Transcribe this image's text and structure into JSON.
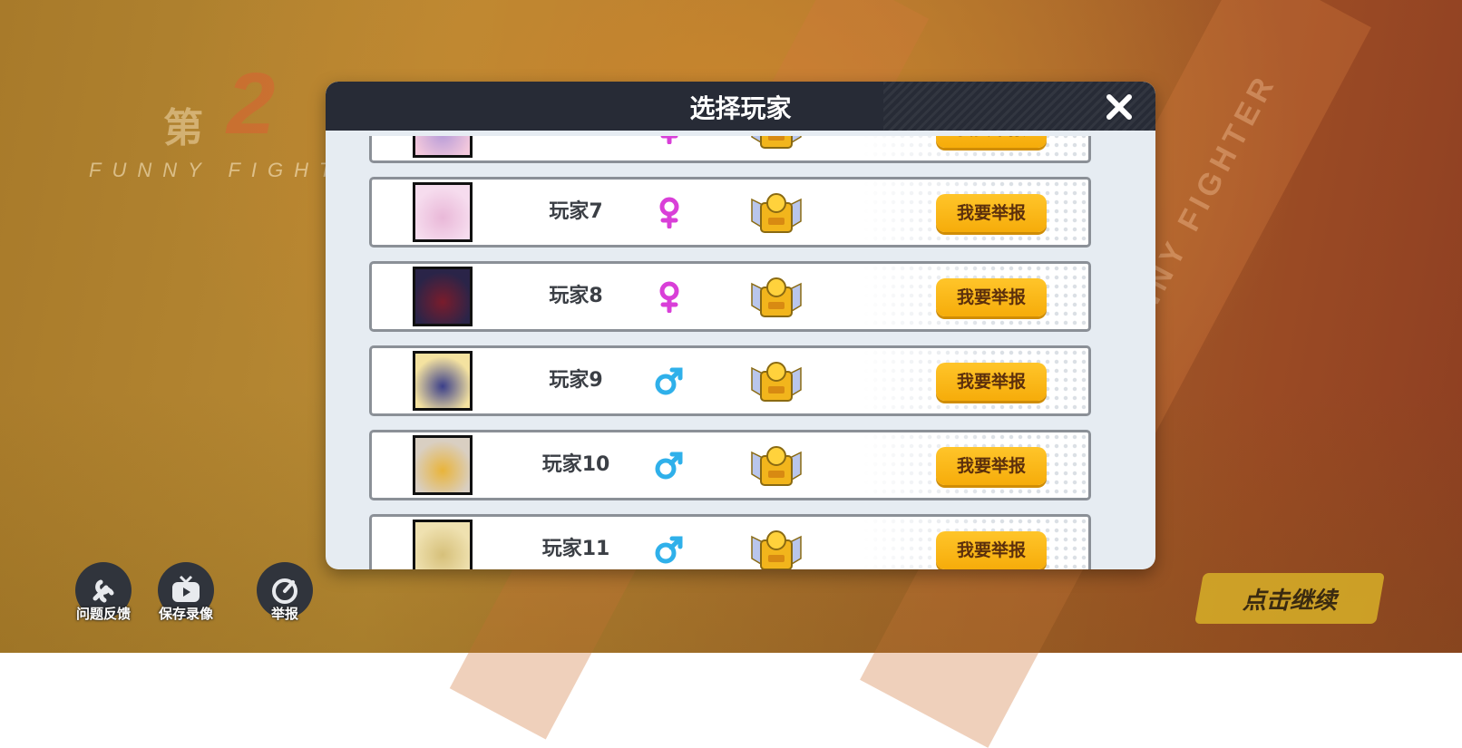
{
  "background": {
    "logo_round_prefix": "第",
    "logo_round_number": "2",
    "logo_subtitle": "FUNNY FIGHTER",
    "side_text": "FUNNY FIGHTER"
  },
  "dialog": {
    "title": "选择玩家",
    "close_icon": "close-icon"
  },
  "players": [
    {
      "name": "",
      "gender": "female",
      "gender_color": "#d93fd8",
      "avatar_color": "#f3c8dc",
      "avatar_accent": "#b69bd8"
    },
    {
      "name": "玩家7",
      "gender": "female",
      "gender_color": "#d93fd8",
      "avatar_color": "#f6dcee",
      "avatar_accent": "#e9b8d8"
    },
    {
      "name": "玩家8",
      "gender": "female",
      "gender_color": "#d93fd8",
      "avatar_color": "#2a2448",
      "avatar_accent": "#7a1c2c"
    },
    {
      "name": "玩家9",
      "gender": "male",
      "gender_color": "#2fb0ea",
      "avatar_color": "#f4e2a0",
      "avatar_accent": "#3b3f8a"
    },
    {
      "name": "玩家10",
      "gender": "male",
      "gender_color": "#2fb0ea",
      "avatar_color": "#d9cfc2",
      "avatar_accent": "#e9b43a"
    },
    {
      "name": "玩家11",
      "gender": "male",
      "gender_color": "#2fb0ea",
      "avatar_color": "#efe1b0",
      "avatar_accent": "#d6c07a"
    }
  ],
  "report_label": "我要举报",
  "toolbar": {
    "feedback_label": "问题反馈",
    "save_replay_label": "保存录像",
    "report_label": "举报"
  },
  "continue_label": "点击继续",
  "colors": {
    "header_bg": "#272b36",
    "report_button": "#f6ac0a",
    "female": "#d93fd8",
    "male": "#2fb0ea"
  }
}
